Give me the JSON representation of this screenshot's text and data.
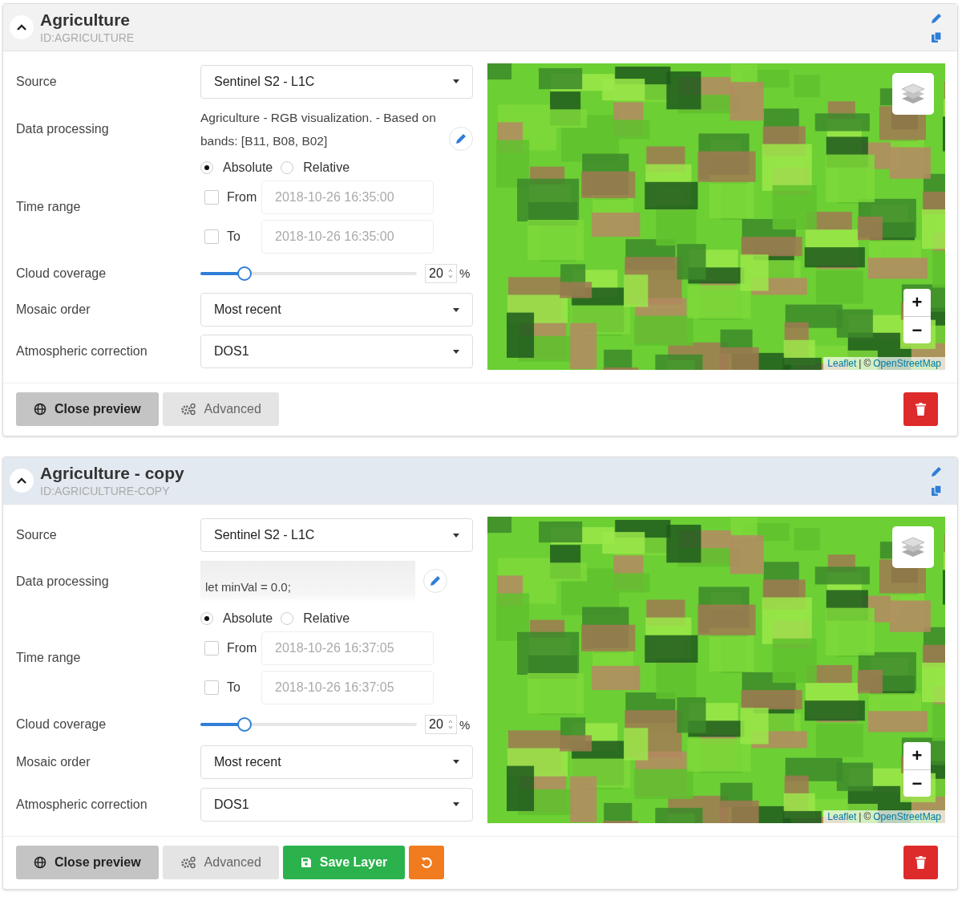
{
  "layers": [
    {
      "title": "Agriculture",
      "id": "ID:AGRICULTURE",
      "expanded": true,
      "highlighted": false,
      "fields": {
        "source": {
          "label": "Source",
          "value": "Sentinel S2 - L1C"
        },
        "processing": {
          "label": "Data processing",
          "kind": "description",
          "text": "Agriculture - RGB visualization. - Based on bands: [B11, B08, B02]"
        },
        "time": {
          "label": "Time range",
          "modes": [
            {
              "label": "Absolute",
              "selected": true
            },
            {
              "label": "Relative",
              "selected": false
            }
          ],
          "bounds": [
            {
              "label": "From",
              "checked": false,
              "placeholder": "2018-10-26 16:35:00"
            },
            {
              "label": "To",
              "checked": false,
              "placeholder": "2018-10-26 16:35:00"
            }
          ]
        },
        "cloud": {
          "label": "Cloud coverage",
          "level": 0.2,
          "value": "20",
          "unit": "%"
        },
        "mosaic": {
          "label": "Mosaic order",
          "value": "Most recent"
        },
        "atmos": {
          "label": "Atmospheric correction",
          "value": "DOS1"
        }
      },
      "map": {
        "zoom_in": "+",
        "zoom_out": "−",
        "attribution": [
          {
            "kind": "link",
            "text": "Leaflet"
          },
          {
            "kind": "separator",
            "text": "|"
          },
          {
            "kind": "text",
            "text": "©"
          },
          {
            "kind": "link",
            "text": "OpenStreetMap"
          }
        ]
      },
      "buttons": [
        {
          "kind": "preview",
          "label": "Close preview"
        },
        {
          "kind": "advanced",
          "label": "Advanced"
        }
      ]
    },
    {
      "title": "Agriculture - copy",
      "id": "ID:AGRICULTURE-COPY",
      "expanded": true,
      "highlighted": true,
      "fields": {
        "source": {
          "label": "Source",
          "value": "Sentinel S2 - L1C"
        },
        "processing": {
          "label": "Data processing",
          "kind": "code",
          "text": "let minVal = 0.0;"
        },
        "time": {
          "label": "Time range",
          "modes": [
            {
              "label": "Absolute",
              "selected": true
            },
            {
              "label": "Relative",
              "selected": false
            }
          ],
          "bounds": [
            {
              "label": "From",
              "checked": false,
              "placeholder": "2018-10-26 16:37:05"
            },
            {
              "label": "To",
              "checked": false,
              "placeholder": "2018-10-26 16:37:05"
            }
          ]
        },
        "cloud": {
          "label": "Cloud coverage",
          "level": 0.2,
          "value": "20",
          "unit": "%"
        },
        "mosaic": {
          "label": "Mosaic order",
          "value": "Most recent"
        },
        "atmos": {
          "label": "Atmospheric correction",
          "value": "DOS1"
        }
      },
      "map": {
        "zoom_in": "+",
        "zoom_out": "−",
        "attribution": [
          {
            "kind": "link",
            "text": "Leaflet"
          },
          {
            "kind": "separator",
            "text": "|"
          },
          {
            "kind": "text",
            "text": "©"
          },
          {
            "kind": "link",
            "text": "OpenStreetMap"
          }
        ]
      },
      "buttons": [
        {
          "kind": "preview",
          "label": "Close preview"
        },
        {
          "kind": "advanced",
          "label": "Advanced"
        },
        {
          "kind": "save",
          "label": "Save Layer"
        },
        {
          "kind": "reset"
        }
      ]
    }
  ]
}
